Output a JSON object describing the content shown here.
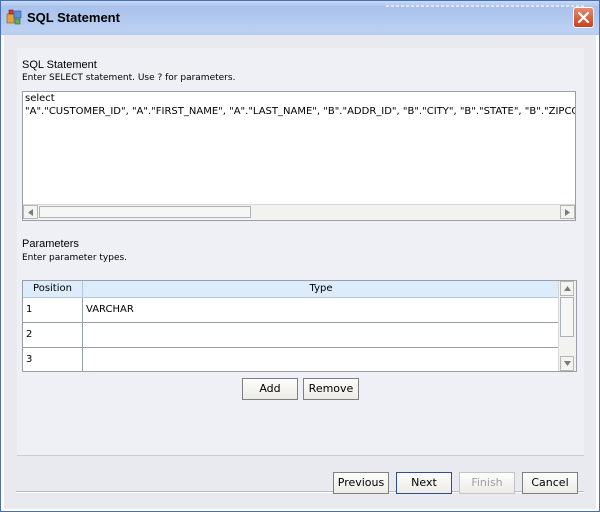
{
  "window": {
    "title": "SQL Statement"
  },
  "sql": {
    "heading": "SQL Statement",
    "description": "Enter SELECT statement.  Use ? for parameters.",
    "lines": [
      "select",
      " \"A\".\"CUSTOMER_ID\", \"A\".\"FIRST_NAME\", \"A\".\"LAST_NAME\", \"B\".\"ADDR_ID\", \"B\".\"CITY\", \"B\".\"STATE\", \"B\".\"ZIPCODE\""
    ]
  },
  "parameters": {
    "heading": "Parameters",
    "description": "Enter parameter types.",
    "columns": [
      "Position",
      "Type"
    ],
    "rows": [
      {
        "position": "1",
        "type": "VARCHAR"
      },
      {
        "position": "2",
        "type": ""
      },
      {
        "position": "3",
        "type": ""
      }
    ],
    "add_label": "Add",
    "remove_label": "Remove"
  },
  "footer": {
    "previous_label": "Previous",
    "next_label": "Next",
    "finish_label": "Finish",
    "cancel_label": "Cancel"
  },
  "colors": {
    "title_bar": "#b5cbef",
    "close_button": "#d8532f",
    "grid_header": "#dcecfa",
    "content_bg": "#eef0f6"
  },
  "icons": [
    "app-icon",
    "close-icon",
    "arrow-left-icon",
    "arrow-right-icon",
    "arrow-up-icon",
    "arrow-down-icon"
  ]
}
